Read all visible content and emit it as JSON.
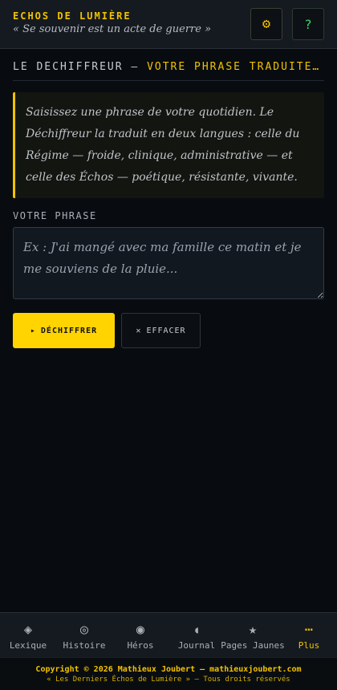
{
  "header": {
    "title": "ECHOS DE LUMIÈRE",
    "motto": "« Se souvenir est un acte de guerre »",
    "settings_icon": "gear-icon",
    "settings_glyph": "⚙",
    "help_icon": "help-icon",
    "help_glyph": "?"
  },
  "section": {
    "title_prefix": "LE DÉCHIFFREUR — ",
    "title_accent": "VOTRE PHRASE TRADUITE…"
  },
  "intro": {
    "text": "Saisissez une phrase de votre quotidien. Le Déchiffreur la traduit en deux langues : celle du Régime — froide, clinique, administrative — et celle des Échos — poétique, résistante, vivante."
  },
  "form": {
    "label": "VOTRE PHRASE",
    "placeholder": "Ex : J'ai mangé avec ma famille ce matin et je me souviens de la pluie...",
    "value": ""
  },
  "actions": {
    "decipher_glyph": "▸",
    "decipher_label": "DÉCHIFFRER",
    "clear_glyph": "✕",
    "clear_label": "EFFACER"
  },
  "nav": {
    "items": [
      {
        "label": "Lexique",
        "glyph": "◈",
        "icon": "diamond-icon"
      },
      {
        "label": "Histoire",
        "glyph": "◎",
        "icon": "target-icon"
      },
      {
        "label": "Héros",
        "glyph": "◉",
        "icon": "circle-dot-icon"
      },
      {
        "label": "Journal",
        "glyph": "◖",
        "icon": "half-moon-icon"
      },
      {
        "label": "Pages Jaunes",
        "glyph": "★",
        "icon": "star-icon"
      },
      {
        "label": "Plus",
        "glyph": "⋯",
        "icon": "more-icon"
      }
    ],
    "active_index": 5
  },
  "footer": {
    "copyright": "Copyright © 2026 Mathieux Joubert — mathieuxjoubert.com",
    "rights": "« Les Derniers Échos de Lumière » — Tous droits réservés"
  },
  "colors": {
    "accent": "#f2c200",
    "help": "#36d46c",
    "background": "#080c10"
  }
}
